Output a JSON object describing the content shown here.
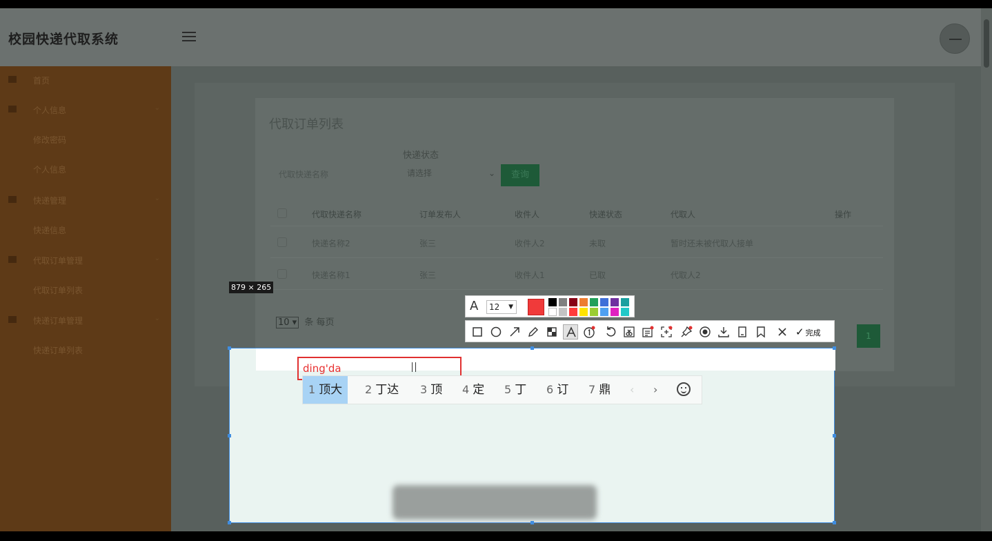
{
  "app": {
    "title": "校园快递代取系统"
  },
  "sidebar": {
    "items": [
      {
        "label": "首页",
        "type": "top"
      },
      {
        "label": "个人信息",
        "type": "group"
      },
      {
        "label": "修改密码",
        "type": "sub"
      },
      {
        "label": "个人信息",
        "type": "sub"
      },
      {
        "label": "快递管理",
        "type": "group"
      },
      {
        "label": "快递信息",
        "type": "sub"
      },
      {
        "label": "代取订单管理",
        "type": "group"
      },
      {
        "label": "代取订单列表",
        "type": "sub"
      },
      {
        "label": "快递订单管理",
        "type": "group"
      },
      {
        "label": "快递订单列表",
        "type": "sub"
      }
    ]
  },
  "main": {
    "card_title": "代取订单列表",
    "search_placeholder": "代取快递名称",
    "status_label": "快递状态",
    "status_value": "请选择",
    "query_button": "查询",
    "columns": [
      "代取快递名称",
      "订单发布人",
      "收件人",
      "快递状态",
      "代取人",
      "操作"
    ],
    "rows": [
      {
        "name": "快递名称2",
        "publisher": "张三",
        "recipient": "收件人2",
        "status": "未取",
        "taker": "暂时还未被代取人接单"
      },
      {
        "name": "快递名称1",
        "publisher": "张三",
        "recipient": "收件人1",
        "status": "已取",
        "taker": "代取人2"
      }
    ],
    "page_size": "10",
    "page_size_suffix": "条 每页",
    "current_page": "1"
  },
  "capture": {
    "size_badge": "879 × 265",
    "text_value": "ding'da",
    "font_size": "12",
    "done_label": "完成",
    "current_color": "#f03a3a",
    "swatches": [
      "#000000",
      "#7f7f7f",
      "#880015",
      "#ed7d31",
      "#22a05a",
      "#3f6fd8",
      "#7030a0",
      "#1aa0a0",
      "#ffffff",
      "#c3c3c3",
      "#ff3b3b",
      "#ffe400",
      "#9acd32",
      "#4ea0f0",
      "#e020c0",
      "#20c8c8"
    ],
    "tools": [
      "rectangle-icon",
      "ellipse-icon",
      "arrow-icon",
      "pen-icon",
      "mosaic-icon",
      "text-icon",
      "number-marker-icon",
      "undo-icon",
      "scissors-icon",
      "ocr-icon",
      "long-screenshot-icon",
      "pin-icon",
      "record-icon",
      "download-icon",
      "copy-icon",
      "bookmark-icon",
      "close-icon"
    ]
  },
  "ime": {
    "candidates": [
      {
        "num": "1",
        "text": "顶大"
      },
      {
        "num": "2",
        "text": "丁达"
      },
      {
        "num": "3",
        "text": "顶"
      },
      {
        "num": "4",
        "text": "定"
      },
      {
        "num": "5",
        "text": "丁"
      },
      {
        "num": "6",
        "text": "订"
      },
      {
        "num": "7",
        "text": "鼎"
      }
    ],
    "prev": "‹",
    "next": "›"
  }
}
